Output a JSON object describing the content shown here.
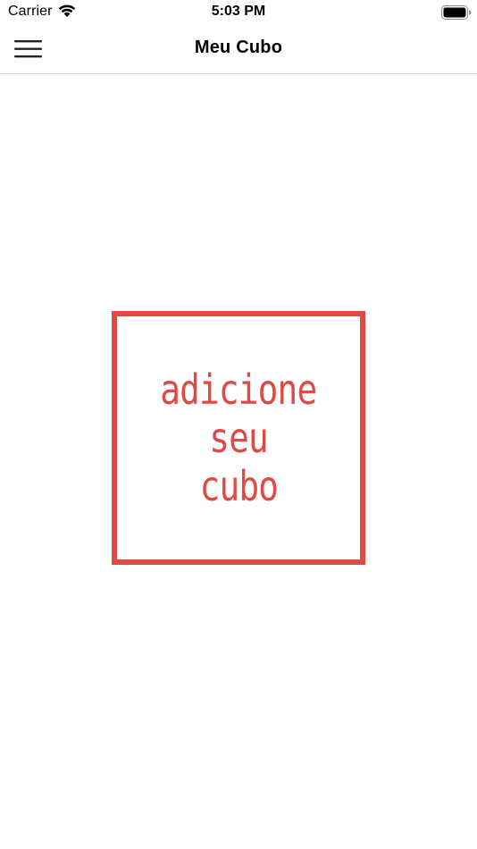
{
  "status_bar": {
    "carrier": "Carrier",
    "time": "5:03 PM",
    "wifi_icon": "wifi-icon",
    "battery_icon": "battery-icon"
  },
  "nav_bar": {
    "title": "Meu Cubo",
    "menu_icon": "hamburger-menu-icon"
  },
  "placeholder": {
    "lines": [
      "adicione",
      "seu",
      "cubo"
    ],
    "accent_color": "#e04a46"
  }
}
